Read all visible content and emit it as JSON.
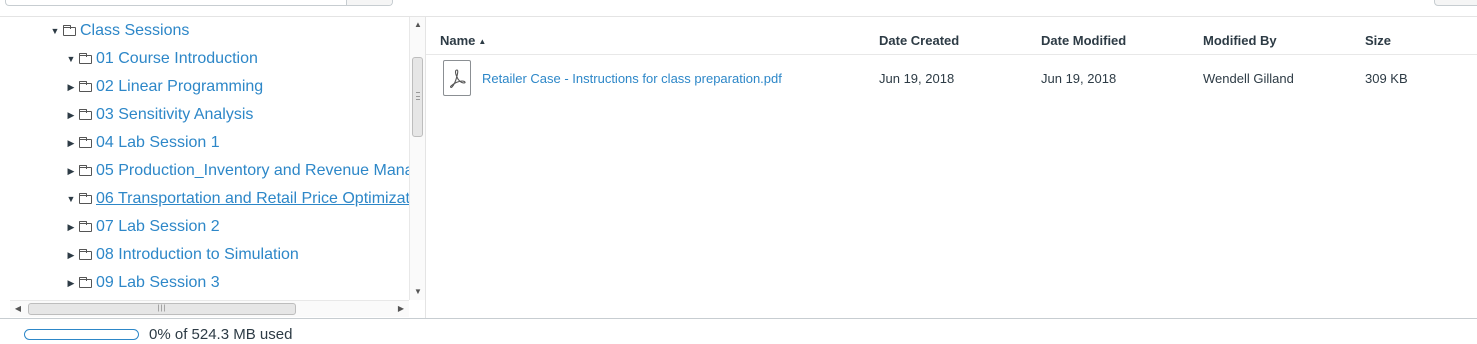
{
  "tree": {
    "items": [
      {
        "label": "Class Sessions",
        "expanded": true,
        "depth": 0
      },
      {
        "label": "01 Course Introduction",
        "expanded": true,
        "depth": 1
      },
      {
        "label": "02 Linear Programming",
        "expanded": false,
        "depth": 1
      },
      {
        "label": "03 Sensitivity Analysis",
        "expanded": false,
        "depth": 1
      },
      {
        "label": "04 Lab Session 1",
        "expanded": false,
        "depth": 1
      },
      {
        "label": "05 Production_Inventory and Revenue Mana",
        "expanded": false,
        "depth": 1
      },
      {
        "label": "06 Transportation and Retail Price Optimizat",
        "expanded": true,
        "depth": 1,
        "active": true
      },
      {
        "label": "07 Lab Session 2",
        "expanded": false,
        "depth": 1
      },
      {
        "label": "08 Introduction to Simulation",
        "expanded": false,
        "depth": 1
      },
      {
        "label": "09 Lab Session 3",
        "expanded": false,
        "depth": 1
      }
    ]
  },
  "file_list": {
    "columns": {
      "name": "Name",
      "date_created": "Date Created",
      "date_modified": "Date Modified",
      "modified_by": "Modified By",
      "size": "Size"
    },
    "sort_indicator": "▲",
    "rows": [
      {
        "name": "Retailer Case - Instructions for class preparation.pdf",
        "date_created": "Jun 19, 2018",
        "date_modified": "Jun 19, 2018",
        "modified_by": "Wendell Gilland",
        "size": "309 KB",
        "icon": "pdf-file-icon"
      }
    ]
  },
  "quota": {
    "text": "0% of 524.3 MB used",
    "fraction_used": 0
  },
  "colors": {
    "link": "#2d87c8",
    "text": "#2d3b45",
    "border": "#c7cdd1"
  }
}
